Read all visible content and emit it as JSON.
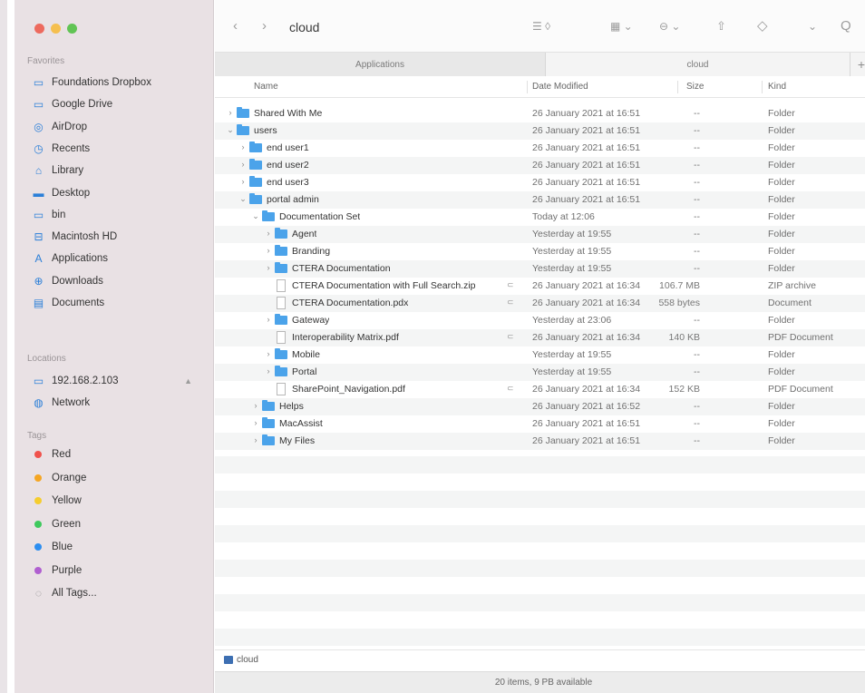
{
  "window": {
    "title": "cloud"
  },
  "colors": {
    "close": "#ed6a5e",
    "minimize": "#f5bf4f",
    "zoom": "#61c454",
    "folder": "#4ba3ea",
    "accent": "#2b7fd8"
  },
  "sidebar": {
    "favorites_label": "Favorites",
    "favorites": [
      {
        "label": "Foundations Dropbox",
        "icon": "folder-icon"
      },
      {
        "label": "Google Drive",
        "icon": "folder-icon"
      },
      {
        "label": "AirDrop",
        "icon": "airdrop-icon"
      },
      {
        "label": "Recents",
        "icon": "clock-icon"
      },
      {
        "label": "Library",
        "icon": "library-icon"
      },
      {
        "label": "Desktop",
        "icon": "desktop-icon"
      },
      {
        "label": "bin",
        "icon": "folder-icon"
      },
      {
        "label": "Macintosh HD",
        "icon": "disk-icon"
      },
      {
        "label": "Applications",
        "icon": "applications-icon"
      },
      {
        "label": "Downloads",
        "icon": "downloads-icon"
      },
      {
        "label": "Documents",
        "icon": "documents-icon"
      }
    ],
    "locations_label": "Locations",
    "locations": [
      {
        "label": "192.168.2.103",
        "icon": "monitor-icon"
      },
      {
        "label": "Network",
        "icon": "network-icon"
      }
    ],
    "tags_label": "Tags",
    "tags": [
      {
        "label": "Red",
        "color": "#f0524c"
      },
      {
        "label": "Orange",
        "color": "#f5a623"
      },
      {
        "label": "Yellow",
        "color": "#f5cd2f"
      },
      {
        "label": "Green",
        "color": "#3fc95d"
      },
      {
        "label": "Blue",
        "color": "#2d8ef0"
      },
      {
        "label": "Purple",
        "color": "#b05fd0"
      }
    ],
    "all_tags_label": "All Tags..."
  },
  "toolbar": {
    "back": "‹",
    "forward": "›",
    "title": "cloud",
    "view_list": "☰ ◊",
    "group": "▦ ⌄",
    "action": "⊖ ⌄",
    "share": "⇧",
    "tag": "◇",
    "more": "⌄",
    "search": "Q"
  },
  "tabs": [
    {
      "label": "Applications"
    },
    {
      "label": "cloud"
    }
  ],
  "tab_add": "+",
  "columns": {
    "name": "Name",
    "date": "Date Modified",
    "size": "Size",
    "kind": "Kind"
  },
  "rows": [
    {
      "name": "Shared With Me",
      "date": "26 January 2021 at 16:51",
      "size": "--",
      "kind": "Folder",
      "depth": 0,
      "type": "folder",
      "exp": "closed"
    },
    {
      "name": "users",
      "date": "26 January 2021 at 16:51",
      "size": "--",
      "kind": "Folder",
      "depth": 0,
      "type": "folder",
      "exp": "open"
    },
    {
      "name": "end user1",
      "date": "26 January 2021 at 16:51",
      "size": "--",
      "kind": "Folder",
      "depth": 1,
      "type": "folder",
      "exp": "closed"
    },
    {
      "name": "end user2",
      "date": "26 January 2021 at 16:51",
      "size": "--",
      "kind": "Folder",
      "depth": 1,
      "type": "folder",
      "exp": "closed"
    },
    {
      "name": "end user3",
      "date": "26 January 2021 at 16:51",
      "size": "--",
      "kind": "Folder",
      "depth": 1,
      "type": "folder",
      "exp": "closed"
    },
    {
      "name": "portal admin",
      "date": "26 January 2021 at 16:51",
      "size": "--",
      "kind": "Folder",
      "depth": 1,
      "type": "folder",
      "exp": "open"
    },
    {
      "name": "Documentation Set",
      "date": "Today at 12:06",
      "size": "--",
      "kind": "Folder",
      "depth": 2,
      "type": "folder",
      "exp": "open"
    },
    {
      "name": "Agent",
      "date": "Yesterday at 19:55",
      "size": "--",
      "kind": "Folder",
      "depth": 3,
      "type": "folder",
      "exp": "closed"
    },
    {
      "name": "Branding",
      "date": "Yesterday at 19:55",
      "size": "--",
      "kind": "Folder",
      "depth": 3,
      "type": "folder",
      "exp": "closed"
    },
    {
      "name": "CTERA Documentation",
      "date": "Yesterday at 19:55",
      "size": "--",
      "kind": "Folder",
      "depth": 3,
      "type": "folder",
      "exp": "closed"
    },
    {
      "name": "CTERA Documentation with Full Search.zip",
      "date": "26 January 2021 at 16:34",
      "size": "106.7 MB",
      "kind": "ZIP archive",
      "depth": 3,
      "type": "file",
      "exp": "none",
      "cloud": "⊂"
    },
    {
      "name": "CTERA Documentation.pdx",
      "date": "26 January 2021 at 16:34",
      "size": "558 bytes",
      "kind": "Document",
      "depth": 3,
      "type": "file",
      "exp": "none",
      "cloud": "⊂"
    },
    {
      "name": "Gateway",
      "date": "Yesterday at 23:06",
      "size": "--",
      "kind": "Folder",
      "depth": 3,
      "type": "folder",
      "exp": "closed"
    },
    {
      "name": "Interoperability Matrix.pdf",
      "date": "26 January 2021 at 16:34",
      "size": "140 KB",
      "kind": "PDF Document",
      "depth": 3,
      "type": "file",
      "exp": "none",
      "cloud": "⊂"
    },
    {
      "name": "Mobile",
      "date": "Yesterday at 19:55",
      "size": "--",
      "kind": "Folder",
      "depth": 3,
      "type": "folder",
      "exp": "closed"
    },
    {
      "name": "Portal",
      "date": "Yesterday at 19:55",
      "size": "--",
      "kind": "Folder",
      "depth": 3,
      "type": "folder",
      "exp": "closed"
    },
    {
      "name": "SharePoint_Navigation.pdf",
      "date": "26 January 2021 at 16:34",
      "size": "152 KB",
      "kind": "PDF Document",
      "depth": 3,
      "type": "file",
      "exp": "none",
      "cloud": "⊂"
    },
    {
      "name": "Helps",
      "date": "26 January 2021 at 16:52",
      "size": "--",
      "kind": "Folder",
      "depth": 2,
      "type": "folder",
      "exp": "closed"
    },
    {
      "name": "MacAssist",
      "date": "26 January 2021 at 16:51",
      "size": "--",
      "kind": "Folder",
      "depth": 2,
      "type": "folder",
      "exp": "closed"
    },
    {
      "name": "My Files",
      "date": "26 January 2021 at 16:51",
      "size": "--",
      "kind": "Folder",
      "depth": 2,
      "type": "folder",
      "exp": "closed"
    }
  ],
  "pathbar": {
    "label": "cloud"
  },
  "status": {
    "text": "20 items, 9 PB available"
  }
}
